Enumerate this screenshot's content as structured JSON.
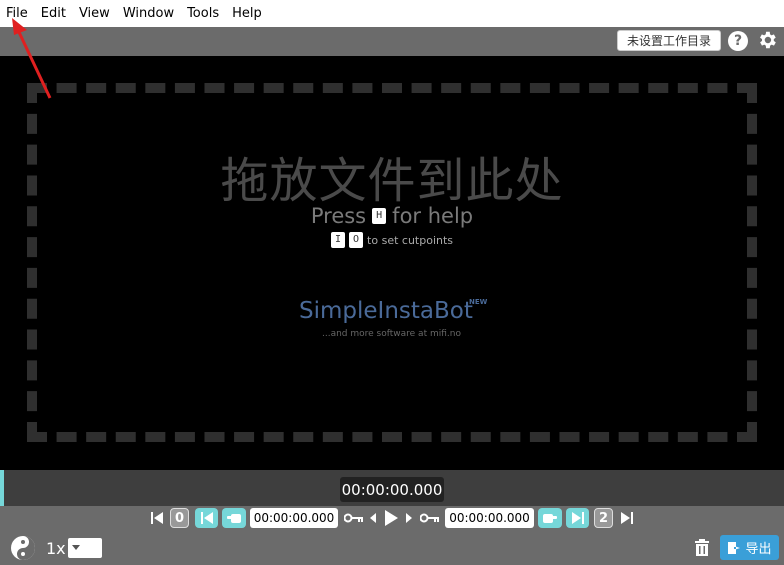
{
  "menu": {
    "items": [
      {
        "label": "File"
      },
      {
        "label": "Edit"
      },
      {
        "label": "View"
      },
      {
        "label": "Window"
      },
      {
        "label": "Tools"
      },
      {
        "label": "Help"
      }
    ]
  },
  "toolbar": {
    "workdir_label": "未设置工作目录",
    "help_label": "?"
  },
  "droparea": {
    "title": "拖放文件到此处",
    "press_prefix": "Press",
    "press_key": "H",
    "press_suffix": "for help",
    "cut_key_in": "I",
    "cut_key_out": "O",
    "cut_text": "to set cutpoints",
    "ad_title": "SimpleInstaBot",
    "ad_badge": "NEW",
    "ad_sub": "...and more software at mifi.no"
  },
  "timeline": {
    "current_time": "00:00:00.000"
  },
  "controls": {
    "start_segment": "0",
    "start_time": "00:00:00.000",
    "end_time": "00:00:00.000",
    "end_segment": "2",
    "speed": "1x",
    "export_label": "导出"
  },
  "colors": {
    "accent_teal": "#76d7d9",
    "export_blue": "#3a9fd8",
    "annotation_red": "#e02020"
  }
}
